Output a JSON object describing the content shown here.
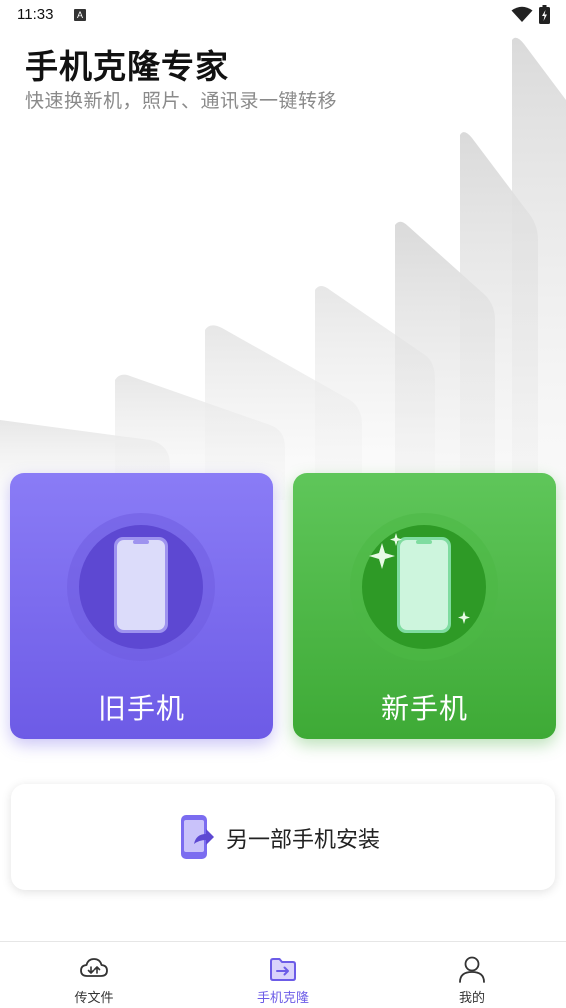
{
  "status_bar": {
    "time": "11:33",
    "notification_letter": "A",
    "icons": [
      "wifi-icon",
      "battery-charging-icon"
    ]
  },
  "header": {
    "title": "手机克隆专家",
    "subtitle": "快速换新机，照片、通讯录一键转移"
  },
  "cards": {
    "old_phone": {
      "label": "旧手机",
      "color": "#7b6cf0",
      "icon": "phone-icon"
    },
    "new_phone": {
      "label": "新手机",
      "color": "#4cb845",
      "icon": "phone-sparkle-icon"
    }
  },
  "install_panel": {
    "label": "另一部手机安装",
    "icon": "phone-share-icon"
  },
  "bottom_nav": {
    "items": [
      {
        "label": "传文件",
        "icon": "cloud-transfer-icon",
        "active": false
      },
      {
        "label": "手机克隆",
        "icon": "folder-transfer-icon",
        "active": true
      },
      {
        "label": "我的",
        "icon": "user-icon",
        "active": false
      }
    ],
    "active_color": "#6c5ce7"
  }
}
